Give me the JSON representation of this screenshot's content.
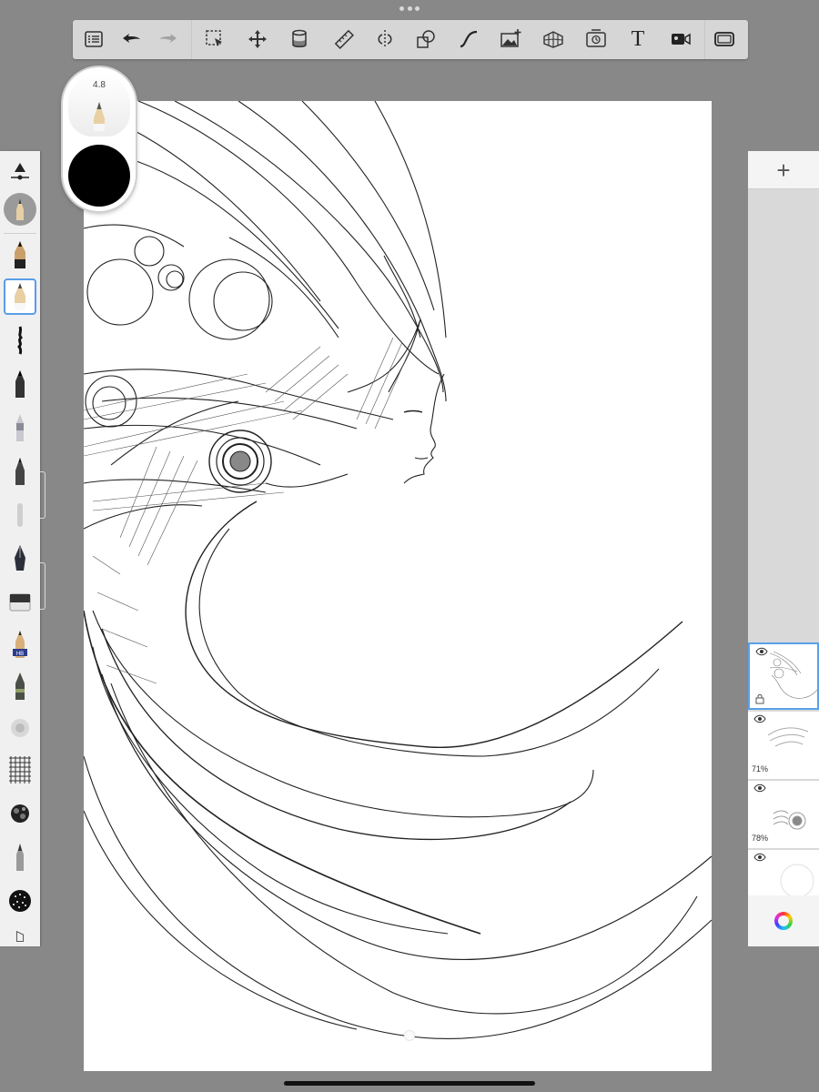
{
  "toolbar": {
    "items": [
      {
        "name": "lists",
        "icon": "list-icon"
      },
      {
        "name": "undo",
        "icon": "undo-icon"
      },
      {
        "name": "redo",
        "icon": "redo-icon",
        "enabled": false
      },
      {
        "name": "select",
        "icon": "selection-icon"
      },
      {
        "name": "transform",
        "icon": "move-icon"
      },
      {
        "name": "fill",
        "icon": "fill-bucket-icon"
      },
      {
        "name": "ruler",
        "icon": "ruler-icon"
      },
      {
        "name": "symmetry",
        "icon": "symmetry-icon"
      },
      {
        "name": "shapes",
        "icon": "shapes-icon"
      },
      {
        "name": "curve",
        "icon": "curve-icon"
      },
      {
        "name": "image",
        "icon": "image-add-icon"
      },
      {
        "name": "perspective",
        "icon": "perspective-grid-icon"
      },
      {
        "name": "timelapse",
        "icon": "timelapse-icon"
      },
      {
        "name": "text",
        "icon": "text-icon",
        "label": "T"
      },
      {
        "name": "record",
        "icon": "video-camera-icon"
      },
      {
        "name": "fullscreen",
        "icon": "fullscreen-icon"
      }
    ]
  },
  "brush_puck": {
    "size": "4.8",
    "color": "#000000"
  },
  "brushes": {
    "selected_index": 1,
    "items": [
      "pencil",
      "pencil-light",
      "ink-splatter",
      "marker",
      "fineliner",
      "ballpoint",
      "smudge",
      "fountain-pen",
      "eraser",
      "pencil-hb",
      "fine-marker",
      "airbrush",
      "grid-texture",
      "charcoal-blot",
      "chisel-pen",
      "stipple-blot"
    ],
    "hb_label": "HB"
  },
  "layers": {
    "add_label": "+",
    "items": [
      {
        "name": "layer-4",
        "opacity": "",
        "active": true,
        "locked": true
      },
      {
        "name": "layer-3",
        "opacity": "71%",
        "active": false
      },
      {
        "name": "layer-2",
        "opacity": "78%",
        "active": false
      },
      {
        "name": "layer-1",
        "opacity": "",
        "active": false
      }
    ]
  },
  "colors": {
    "accent": "#5aa0e8",
    "chrome": "#888888",
    "toolbar": "#d6d6d6",
    "panel": "#f0f0f0",
    "ink": "#111111"
  }
}
